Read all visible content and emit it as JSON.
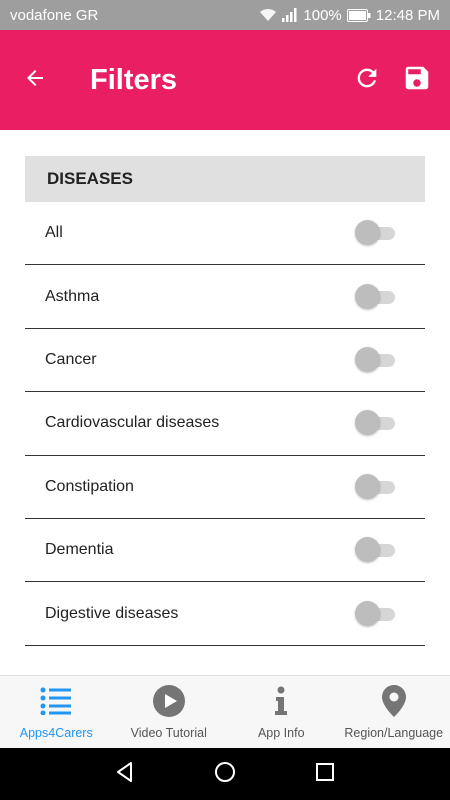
{
  "status_bar": {
    "carrier": "vodafone GR",
    "battery": "100%",
    "time": "12:48 PM"
  },
  "app_bar": {
    "title": "Filters",
    "color": "#e91e63",
    "actions": [
      "refresh-icon",
      "save-icon"
    ]
  },
  "section": {
    "header": "DISEASES"
  },
  "filters": [
    {
      "label": "All",
      "enabled": false
    },
    {
      "label": "Asthma",
      "enabled": false
    },
    {
      "label": "Cancer",
      "enabled": false
    },
    {
      "label": "Cardiovascular diseases",
      "enabled": false
    },
    {
      "label": "Constipation",
      "enabled": false
    },
    {
      "label": "Dementia",
      "enabled": false
    },
    {
      "label": "Digestive diseases",
      "enabled": false
    }
  ],
  "bottom_nav": {
    "active_color": "#2196f3",
    "items": [
      {
        "label": "Apps4Carers",
        "icon": "list-icon",
        "active": true
      },
      {
        "label": "Video Tutorial",
        "icon": "play-circle-icon",
        "active": false
      },
      {
        "label": "App Info",
        "icon": "info-icon",
        "active": false
      },
      {
        "label": "Region/Language",
        "icon": "location-pin-icon",
        "active": false
      }
    ]
  }
}
